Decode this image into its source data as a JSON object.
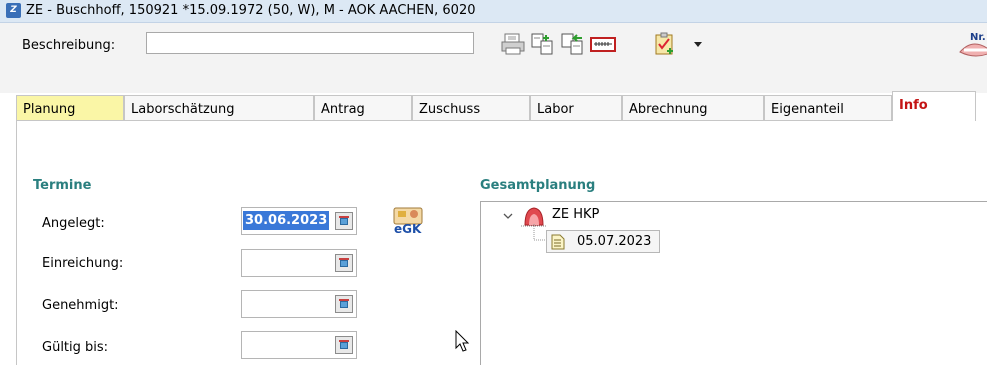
{
  "window": {
    "title": "ZE - Buschhoff, 150921 *15.09.1972 (50, W),  M - AOK AACHEN,  6020",
    "app_icon_text": "Z"
  },
  "toolbar": {
    "description_label": "Beschreibung:",
    "description_value": "",
    "icons": [
      "print-icon",
      "copy-plan-icon",
      "import-plan-icon",
      "xray-icon",
      "checklist-icon",
      "dropdown-arrow-icon",
      "denture-nr-icon"
    ],
    "denture_icon_label": "Nr."
  },
  "tabs": [
    {
      "label": "Planung"
    },
    {
      "label": "Laborschätzung"
    },
    {
      "label": "Antrag"
    },
    {
      "label": "Zuschuss"
    },
    {
      "label": "Labor"
    },
    {
      "label": "Abrechnung"
    },
    {
      "label": "Eigenanteil"
    },
    {
      "label": "Info",
      "active": true
    }
  ],
  "termine": {
    "title": "Termine",
    "fields": [
      {
        "label": "Angelegt:",
        "value": "30.06.2023"
      },
      {
        "label": "Einreichung:",
        "value": ""
      },
      {
        "label": "Genehmigt:",
        "value": ""
      },
      {
        "label": "Gültig bis:",
        "value": ""
      }
    ],
    "egk_label": "eGK"
  },
  "gesamtplanung": {
    "title": "Gesamtplanung",
    "root_label": "ZE HKP",
    "child_label": "05.07.2023"
  },
  "colors": {
    "section_title": "#2a7f7f",
    "active_tab_text": "#c41414",
    "planung_tab_bg": "#faf6a6",
    "selection": "#3a78d8"
  }
}
